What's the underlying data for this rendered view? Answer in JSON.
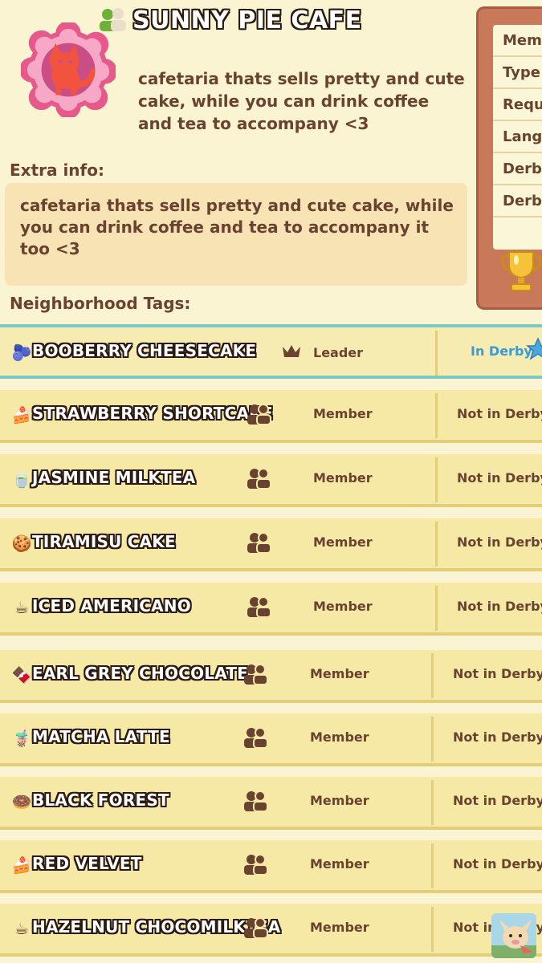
{
  "neighborhood": {
    "name": "SUNNY PIE CAFE",
    "description": "cafetaria thats sells pretty and cute cake, while you can drink coffee and tea to accompany <3"
  },
  "info_panel": {
    "rows": [
      "Mem",
      "Type",
      "Requ",
      "Lang",
      "Derb",
      "Derb"
    ]
  },
  "extra_info": {
    "label": "Extra info:",
    "text": "cafetaria thats sells pretty and cute cake, while you can drink coffee and tea to accompany it too <3"
  },
  "tags_label": "Neighborhood Tags:",
  "members": [
    {
      "emoji": "🫐",
      "name": "BOOBERRY CHEESECAKE",
      "role": "Leader",
      "derby": "In Derby"
    },
    {
      "emoji": "🍰",
      "name": "STRAWBERRY SHORTCAKE",
      "role": "Member",
      "derby": "Not in Derby"
    },
    {
      "emoji": "🍵",
      "name": "JASMINE MILKTEA",
      "role": "Member",
      "derby": "Not in Derby"
    },
    {
      "emoji": "🍪",
      "name": "TIRAMISU CAKE",
      "role": "Member",
      "derby": "Not in Derby"
    },
    {
      "emoji": "☕",
      "name": "ICED AMERICANO",
      "role": "Member",
      "derby": "Not in Derby"
    },
    {
      "emoji": "🍫",
      "name": "EARL GREY CHOCOLATE",
      "role": "Member",
      "derby": "Not in Derby"
    },
    {
      "emoji": "🧋",
      "name": "MATCHA LATTE",
      "role": "Member",
      "derby": "Not in Derby"
    },
    {
      "emoji": "🍩",
      "name": "BLACK FOREST",
      "role": "Member",
      "derby": "Not in Derby"
    },
    {
      "emoji": "🍰",
      "name": "RED VELVET",
      "role": "Member",
      "derby": "Not in Derby"
    },
    {
      "emoji": "☕",
      "name": "HAZELNUT CHOCOMILKTEA",
      "role": "Member",
      "derby": "Not in Derby"
    }
  ],
  "colors": {
    "background": "#fbf4d2",
    "row": "#f6e9a6",
    "leader_border": "#7cc8c4",
    "in_derby": "#3a9ad6",
    "text_brown": "#6a4330",
    "badge_pink": "#f07aa4"
  }
}
